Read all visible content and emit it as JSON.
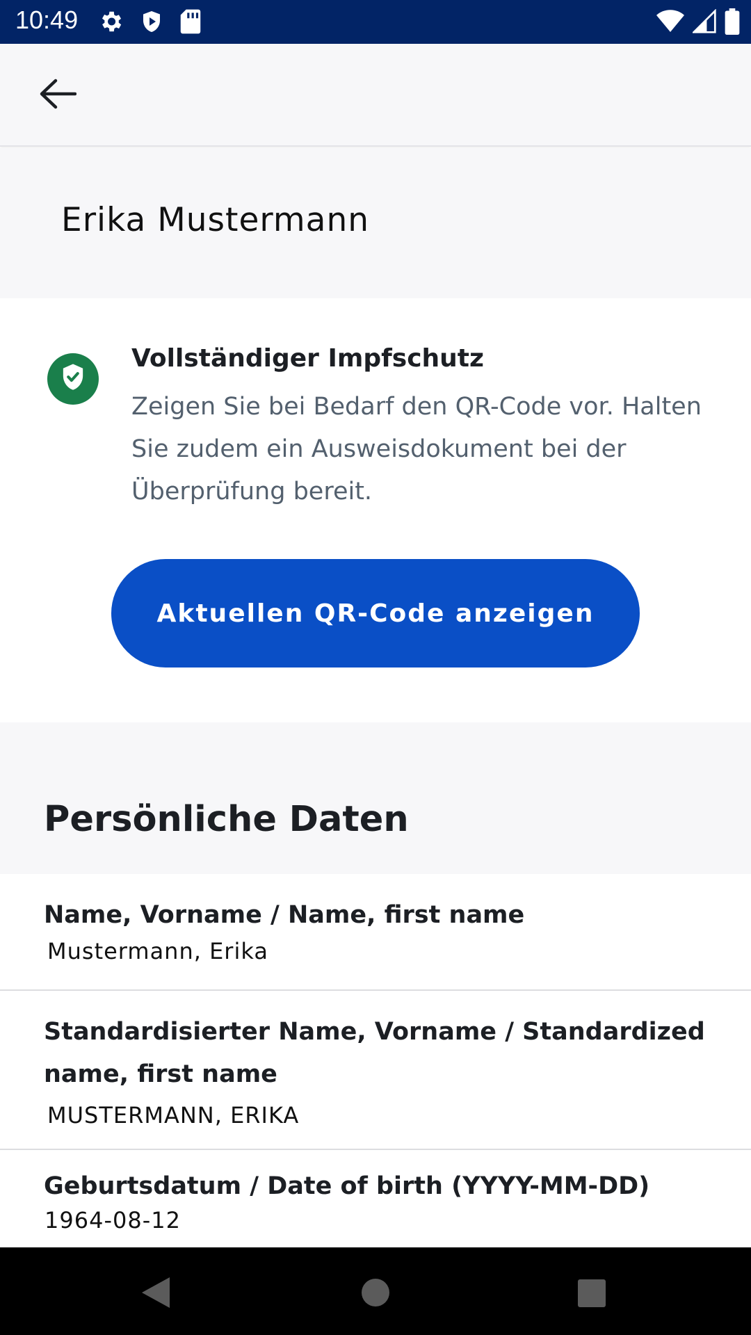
{
  "status_bar": {
    "time": "10:49",
    "left_icons": [
      "gear-icon",
      "shield-icon",
      "sd-card-icon"
    ],
    "right_icons": [
      "wifi-icon",
      "signal-icon",
      "battery-icon"
    ]
  },
  "app_bar": {
    "back_icon": "arrow-left-icon"
  },
  "person": {
    "name": "Erika Mustermann"
  },
  "certificate": {
    "status_icon": "shield-check-icon",
    "status_color": "#1a7f4b",
    "status_title": "Vollständiger Impfschutz",
    "status_description": "Zeigen Sie bei Bedarf den QR-Code vor. Halten Sie zudem ein Ausweisdokument bei der Überprüfung bereit.",
    "qr_button_label": "Aktuellen QR-Code anzeigen",
    "button_color": "#0a4fc6"
  },
  "personal_data": {
    "section_title": "Persönliche Daten",
    "rows": [
      {
        "label": "Name, Vorname / Name, first name",
        "value": "Mustermann, Erika"
      },
      {
        "label": "Standardisierter Name, Vorname / Standardized name, first name",
        "value": "MUSTERMANN, ERIKA"
      },
      {
        "label": "Geburtsdatum / Date of birth (YYYY-MM-DD)",
        "value": "1964-08-12"
      }
    ]
  },
  "nav_bar": {
    "icons": [
      "back-triangle-icon",
      "home-circle-icon",
      "recents-square-icon"
    ]
  }
}
